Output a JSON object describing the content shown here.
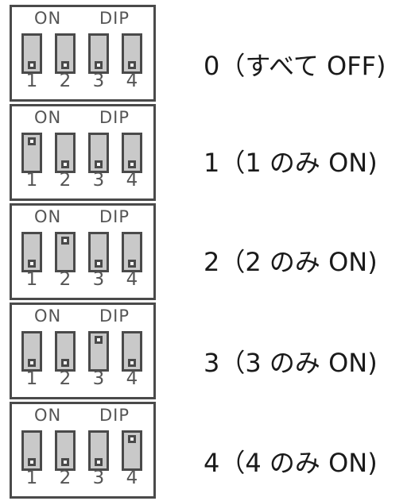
{
  "header": {
    "on_label": "ON",
    "dip_label": "DIP"
  },
  "switch_numbers": [
    "1",
    "2",
    "3",
    "4"
  ],
  "rows": [
    {
      "states": [
        "off",
        "off",
        "off",
        "off"
      ],
      "caption": "0（すべて OFF)"
    },
    {
      "states": [
        "on",
        "off",
        "off",
        "off"
      ],
      "caption": "1（1 のみ ON)"
    },
    {
      "states": [
        "off",
        "on",
        "off",
        "off"
      ],
      "caption": "2（2 のみ ON)"
    },
    {
      "states": [
        "off",
        "off",
        "on",
        "off"
      ],
      "caption": "3（3 のみ ON)"
    },
    {
      "states": [
        "off",
        "off",
        "off",
        "on"
      ],
      "caption": "4（4 のみ ON)"
    }
  ]
}
